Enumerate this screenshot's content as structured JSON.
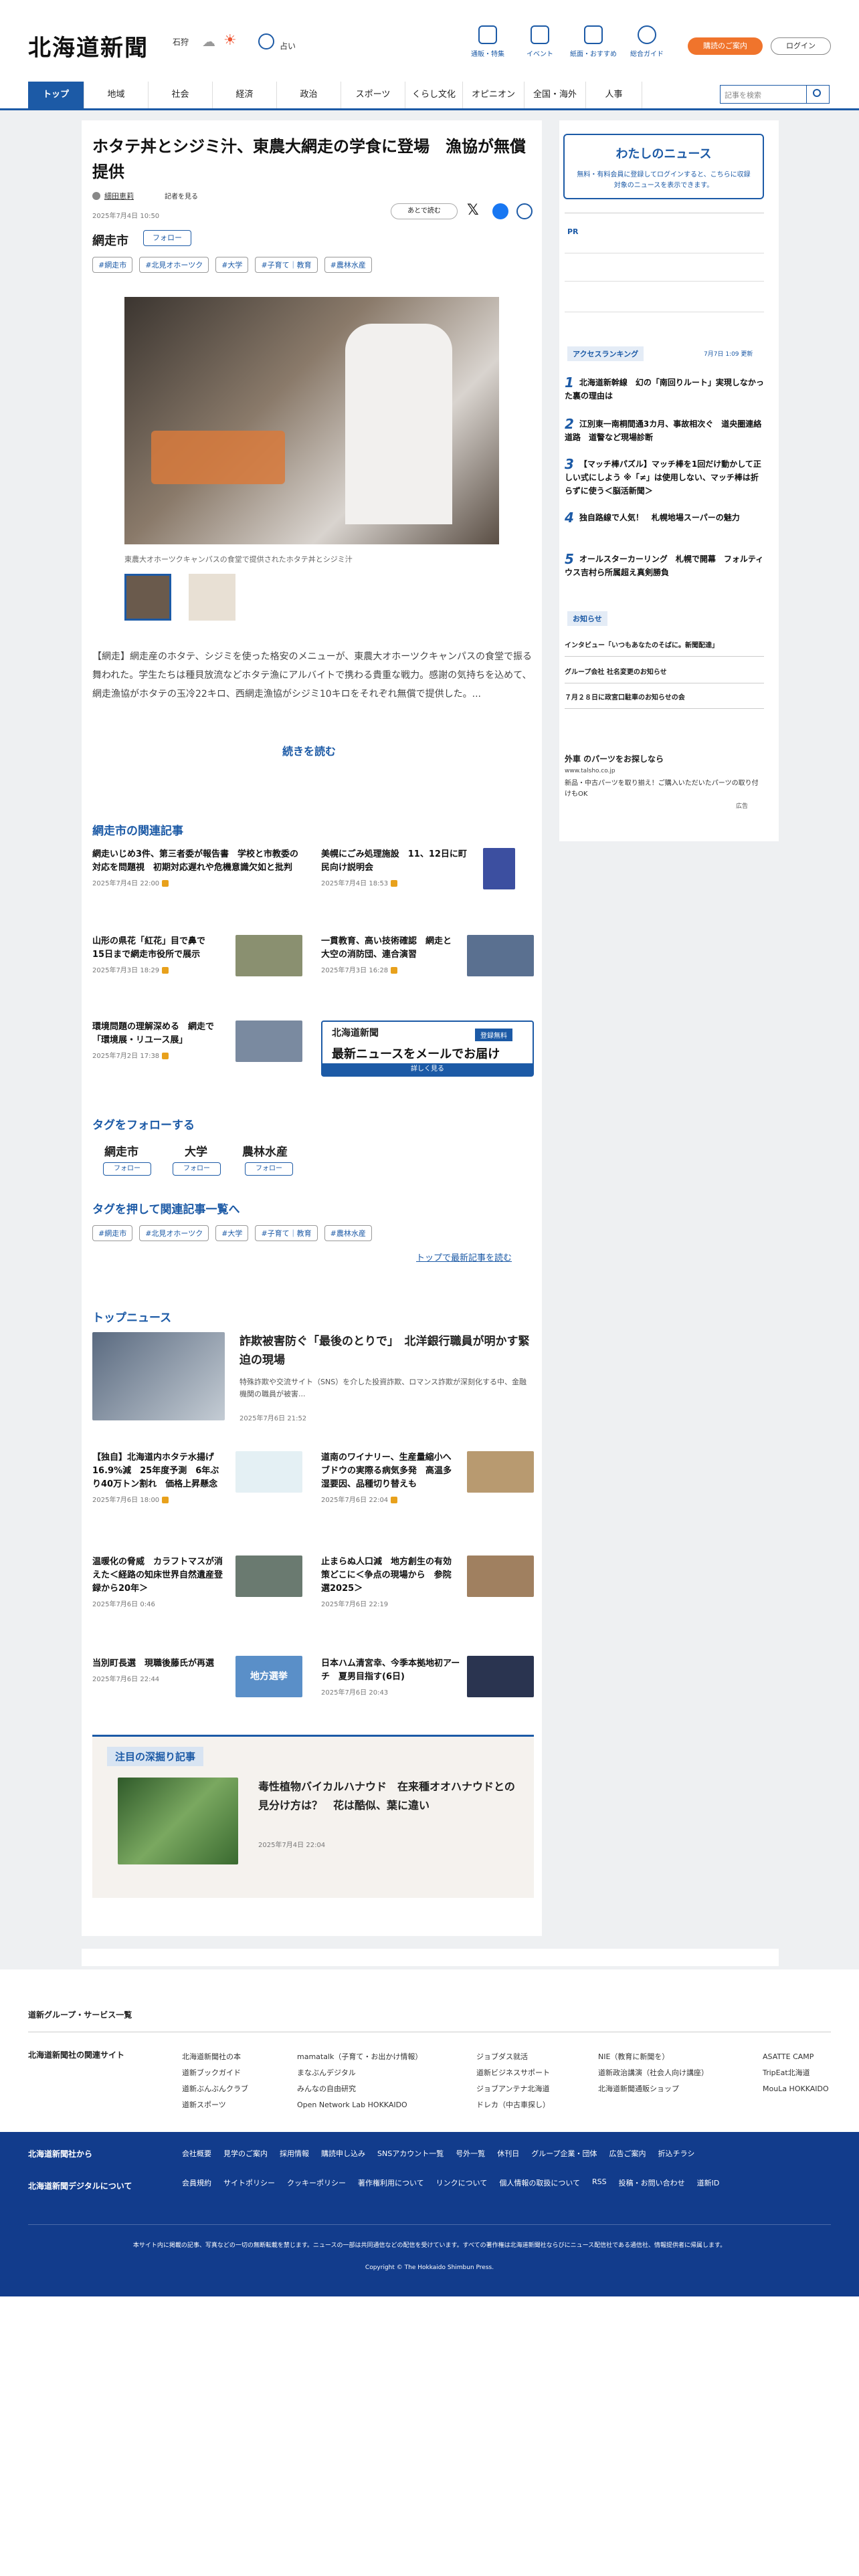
{
  "header": {
    "logo": "北海道新聞",
    "weather_region": "石狩",
    "weather_label": "占い",
    "nav": [
      "通販・特集",
      "イベント",
      "紙面・おすすめ",
      "総合ガイド"
    ],
    "subscribe": "購読のご案内",
    "login": "ログイン",
    "search_placeholder": "記事を検索"
  },
  "gnav": [
    "トップ",
    "地域",
    "社会",
    "経済",
    "政治",
    "スポーツ",
    "くらし文化",
    "オピニオン",
    "全国・海外",
    "人事"
  ],
  "article": {
    "title": "ホタテ丼とシジミ汁、東農大網走の学食に登場　漁協が無償提供",
    "author": "細田恵莉",
    "follow_author": "記者を見る",
    "date": "2025年7月4日 10:50",
    "save": "あとで読む",
    "region": "網走市",
    "region_follow": "フォロー",
    "tags": [
      "#網走市",
      "#北見オホーツク",
      "#大学",
      "#子育て｜教育",
      "#農林水産"
    ],
    "caption": "東農大オホーツクキャンパスの食堂で提供されたホタテ丼とシジミ汁",
    "body": "【網走】網走産のホタテ、シジミを使った格安のメニューが、東農大オホーツクキャンパスの食堂で振る舞われた。学生たちは種貝放流などホタテ漁にアルバイトで携わる貴重な戦力。感謝の気持ちを込めて、網走漁協がホタテの玉冷22キロ、西網走漁協がシジミ10キロをそれぞれ無償で提供した。...",
    "more": "続きを読む"
  },
  "related": {
    "heading": "網走市の関連記事",
    "items": [
      {
        "title": "網走いじめ3件、第三者委が報告書　学校と市教委の対応を問題視　初期対応遅れや危機意識欠如と批判",
        "date": "2025年7月4日 22:00"
      },
      {
        "title": "美幌にごみ処理施設　11、12日に町民向け説明会",
        "date": "2025年7月4日 18:53"
      },
      {
        "title": "山形の県花「紅花」目で鼻で　15日まで網走市役所で展示",
        "date": "2025年7月3日 18:29"
      },
      {
        "title": "一貫教育、高い技術確認　網走と大空の消防団、連合演習",
        "date": "2025年7月3日 16:28"
      },
      {
        "title": "環境問題の理解深める　網走で「環境展・リユース展」",
        "date": "2025年7月2日 17:38"
      }
    ],
    "ad_logo": "北海道新聞",
    "ad_badge": "登録無料",
    "ad_text": "最新ニュースをメールでお届け",
    "ad_more": "詳しく見る"
  },
  "follow_tags": {
    "heading": "タグをフォローする",
    "items": [
      "網走市",
      "大学",
      "農林水産"
    ],
    "btn": "フォロー",
    "list_heading": "タグを押して関連記事一覧へ",
    "latest": "トップで最新記事を読む"
  },
  "top_news": {
    "heading": "トップニュース",
    "lead": {
      "title": "詐欺被害防ぐ「最後のとりで」　北洋銀行職員が明かす緊迫の現場",
      "summary": "特殊詐欺や交流サイト（SNS）を介した投資詐欺、ロマンス詐欺が深刻化する中、金融機関の職員が被害...",
      "date": "2025年7月6日 21:52"
    },
    "items": [
      {
        "title": "【独自】北海道内ホタテ水揚げ16.9%減　25年度予測　6年ぶり40万トン割れ　価格上昇懸念",
        "date": "2025年7月6日 18:00"
      },
      {
        "title": "道南のワイナリー、生産量縮小へ　ブドウの実際る病気多発　高温多湿要因、品種切り替えも",
        "date": "2025年7月6日 22:04"
      },
      {
        "title": "温暖化の脅威　カラフトマスが消えた＜経路の知床世界自然遺産登録から20年＞",
        "date": "2025年7月6日 0:46"
      },
      {
        "title": "止まらぬ人口減　地方創生の有効策どこに＜争点の現場から　参院選2025＞",
        "date": "2025年7月6日 22:19"
      },
      {
        "title": "当別町長選　現職後藤氏が再選",
        "date": "2025年7月6日 22:44"
      },
      {
        "title": "日本ハム清宮幸、今季本拠地初アーチ　夏男目指す(6日)",
        "date": "2025年7月6日 20:43"
      }
    ],
    "thumb_label": "地方選挙"
  },
  "feature": {
    "heading": "注目の深掘り記事",
    "title": "毒性植物バイカルハナウド　在来種オオハナウドとの見分け方は？　花は酷似、葉に違い",
    "date": "2025年7月4日 22:04"
  },
  "sidebar": {
    "mynews_title": "わたしのニュース",
    "mynews_text": "無料・有料会員に登録してログインすると、こちらに収録対象のニュースを表示できます。",
    "pr": "PR",
    "ranking_title": "アクセスランキング",
    "ranking_date": "7月7日 1:09 更新",
    "ranking": [
      "北海道新幹線　幻の「南回りルート」実現しなかった裏の理由は",
      "江別東一南桐間通3カ月、事故相次ぐ　道央圏連絡道路　道警など現場診断",
      "【マッチ棒パズル】マッチ棒を1回だけ動かして正しい式にしよう ※「≠」は使用しない、マッチ棒は折らずに使う＜脳活新聞＞",
      "独自路線で人気！　札幌地場スーパーの魅力",
      "オールスターカーリング　札幌で開幕　フォルティウス吉村ら所属超え真剣勝負"
    ],
    "notice_title": "お知らせ",
    "notices": [
      "インタビュー「いつもあなたのそばに。新聞配達」",
      "グループ会社 社名変更のお知らせ",
      "７月２８日に政宮口駐車のお知らせの会"
    ],
    "ad_title": "外車 のパーツをお探しなら",
    "ad_url": "www.talsho.co.jp",
    "ad_text": "新品・中古パーツを取り揃え！ご購入いただいたパーツの取り付けもOK",
    "ad_mark": "広告"
  },
  "footer": {
    "group_link": "道新グループ・サービス一覧",
    "related_title": "北海道新聞社の関連サイト",
    "col1": [
      "北海道新聞社の本",
      "道新ブックガイド",
      "道新ぶんぶんクラブ",
      "道新スポーツ"
    ],
    "col2": [
      "mamatalk（子育て・お出かけ情報）",
      "まなぶんデジタル",
      "みんなの自由研究",
      "Open Network Lab HOKKAIDO"
    ],
    "col3": [
      "ジョブダス就活",
      "道新ビジネスサポート",
      "ジョブアンテナ北海道",
      "ドレカ（中古車探し）"
    ],
    "col4": [
      "NIE（教育に新聞を）",
      "道新政治講演（社会人向け講座）",
      "北海道新聞通販ショップ"
    ],
    "col5": [
      "ASATTE CAMP",
      "TripEat北海道",
      "MouLa HOKKAIDO"
    ],
    "blue_h1": "北海道新聞社から",
    "blue_h2": "北海道新聞デジタルについて",
    "row1": [
      "会社概要",
      "見学のご案内",
      "採用情報",
      "購読申し込み",
      "SNSアカウント一覧",
      "号外一覧",
      "休刊日",
      "グループ企業・団体",
      "広告ご案内",
      "折込チラシ"
    ],
    "row2": [
      "会員規約",
      "サイトポリシー",
      "クッキーポリシー",
      "著作権利用について",
      "リンクについて",
      "個人情報の取扱について",
      "RSS",
      "投稿・お問い合わせ",
      "道新ID"
    ],
    "notice": "本サイト内に掲載の記事、写真などの一切の無断転載を禁じます。ニュースの一部は共同通信などの配信を受けています。すべての著作権は北海道新聞社ならびにニュース配信社である通信社、情報提供者に帰属します。",
    "copyright": "Copyright © The Hokkaido Shimbun Press."
  }
}
